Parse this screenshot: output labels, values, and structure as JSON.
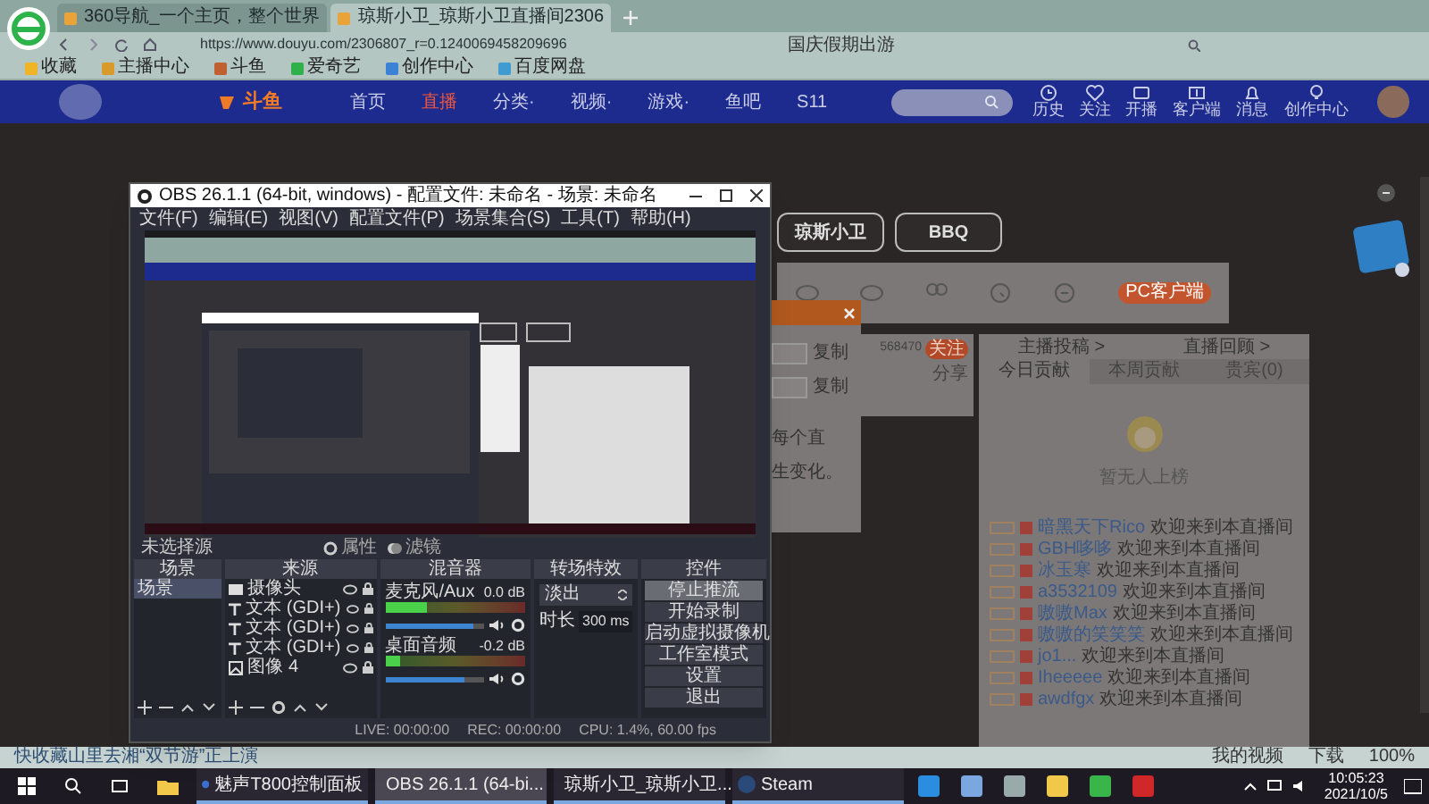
{
  "browser": {
    "tabs": [
      {
        "title": "360导航_一个主页，整个世界",
        "selected": false
      },
      {
        "title": "琼斯小卫_琼斯小卫直播间2306",
        "selected": true
      }
    ],
    "address": "https://www.douyu.com/2306807_r=0.1240069458209696",
    "search_value": "国庆假期出游",
    "bookmarks": [
      "收藏",
      "主播中心",
      "斗鱼",
      "爱奇艺",
      "创作中心",
      "百度网盘"
    ],
    "status_text": "快收藏山里去湘“双节游”正上演",
    "status_items": [
      "我的视频",
      "下载",
      "100%"
    ]
  },
  "site": {
    "logo": "斗鱼",
    "nav": [
      {
        "label": "首页",
        "selected": false
      },
      {
        "label": "直播",
        "selected": true
      },
      {
        "label": "分类·",
        "selected": false
      },
      {
        "label": "视频·",
        "selected": false
      },
      {
        "label": "游戏·",
        "selected": false
      },
      {
        "label": "鱼吧",
        "selected": false
      },
      {
        "label": "S11",
        "selected": false
      }
    ],
    "header_icons": [
      {
        "label": "历史",
        "kind": "history"
      },
      {
        "label": "关注",
        "kind": "heart"
      },
      {
        "label": "开播",
        "kind": "camera"
      },
      {
        "label": "客户端",
        "kind": "download"
      },
      {
        "label": "消息",
        "kind": "bell"
      },
      {
        "label": "创作中心",
        "kind": "bulb"
      }
    ]
  },
  "room": {
    "category_buttons": [
      "琼斯小卫",
      "BBQ"
    ],
    "pc_client_button": "PC客户端",
    "viewers": "568470",
    "follow_button": "关注",
    "share": "分享"
  },
  "dialog": {
    "copy_buttons": [
      "复制",
      "复制"
    ],
    "lines": [
      "每个直",
      "生变化。"
    ]
  },
  "chat": {
    "links": [
      "主播投稿 >",
      "直播回顾 >"
    ],
    "tabs": [
      {
        "label": "今日贡献",
        "selected": true
      },
      {
        "label": "本周贡献",
        "selected": false
      },
      {
        "label": "贵宾(0)",
        "selected": false
      }
    ],
    "empty_text": "暂无人上榜",
    "messages": [
      {
        "user": "暗黑天下Rico",
        "text": "欢迎来到本直播间"
      },
      {
        "user": "GBH哆哆",
        "text": "欢迎来到本直播间"
      },
      {
        "user": "冰玉寒",
        "text": "欢迎来到本直播间"
      },
      {
        "user": "a3532109",
        "text": "欢迎来到本直播间"
      },
      {
        "user": "嗷嗷Max",
        "text": "欢迎来到本直播间"
      },
      {
        "user": "嗷嗷的笑笑笑",
        "text": "欢迎来到本直播间"
      },
      {
        "user": "jo1...",
        "text": "欢迎来到本直播间"
      },
      {
        "user": "Iheeeee",
        "text": "欢迎来到本直播间"
      },
      {
        "user": "awdfgx",
        "text": "欢迎来到本直播间"
      }
    ]
  },
  "obs": {
    "title": "OBS 26.1.1 (64-bit, windows) - 配置文件: 未命名 - 场景: 未命名",
    "menu": [
      "文件(F)",
      "编辑(E)",
      "视图(V)",
      "配置文件(P)",
      "场景集合(S)",
      "工具(T)",
      "帮助(H)"
    ],
    "source_bar": {
      "label": "未选择源",
      "buttons": [
        "属性",
        "滤镜"
      ]
    },
    "docks": [
      "场景",
      "来源",
      "混音器",
      "转场特效",
      "控件"
    ],
    "scenes": [
      {
        "name": "场景",
        "selected": true
      }
    ],
    "sources": [
      {
        "name": "摄像头",
        "kind": "camera"
      },
      {
        "name": "文本 (GDI+)",
        "kind": "text"
      },
      {
        "name": "文本 (GDI+)",
        "kind": "text"
      },
      {
        "name": "文本 (GDI+)",
        "kind": "text"
      },
      {
        "name": "图像 4",
        "kind": "image"
      }
    ],
    "mixer": [
      {
        "name": "麦克风/Aux",
        "reading": "0.0 dB",
        "meter": {
          "level": 0.3
        },
        "fader": {
          "level": 0.9
        }
      },
      {
        "name": "桌面音频",
        "reading": "-0.2 dB",
        "meter": {
          "level": 0.1
        },
        "fader": {
          "level": 0.8
        }
      }
    ],
    "transition": {
      "name": "淡出",
      "duration_label": "时长",
      "duration": "300 ms"
    },
    "controls": [
      {
        "label": "停止推流",
        "selected": true
      },
      {
        "label": "开始录制",
        "selected": false
      },
      {
        "label": "启动虚拟摄像机",
        "selected": false
      },
      {
        "label": "工作室模式",
        "selected": false
      },
      {
        "label": "设置",
        "selected": false
      },
      {
        "label": "退出",
        "selected": false
      }
    ],
    "status": [
      "LIVE: 00:00:00",
      "REC: 00:00:00",
      "CPU: 1.4%, 60.00 fps"
    ]
  },
  "taskbar": {
    "apps": [
      {
        "label": "魅声T800控制面板",
        "selected": false
      },
      {
        "label": "OBS 26.1.1 (64-bi...",
        "selected": true
      },
      {
        "label": "琼斯小卫_琼斯小卫...",
        "selected": false
      },
      {
        "label": "Steam",
        "selected": false
      }
    ],
    "time": "10:05:23",
    "date": "2021/10/5"
  }
}
